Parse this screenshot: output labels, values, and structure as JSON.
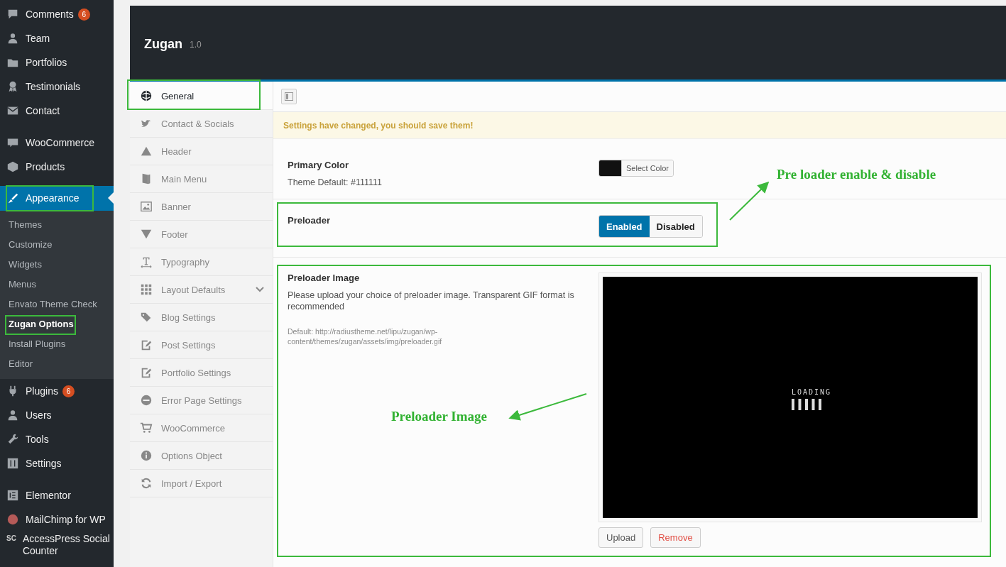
{
  "sidebar": {
    "groups": [
      [
        {
          "label": "Comments",
          "badge": "6",
          "selected": false,
          "highlighted": false
        },
        {
          "label": "Team",
          "selected": false,
          "highlighted": false
        },
        {
          "label": "Portfolios",
          "selected": false,
          "highlighted": false
        },
        {
          "label": "Testimonials",
          "selected": false,
          "highlighted": false
        },
        {
          "label": "Contact",
          "selected": false,
          "highlighted": false
        }
      ],
      [
        {
          "label": "WooCommerce",
          "selected": false,
          "highlighted": false
        },
        {
          "label": "Products",
          "selected": false,
          "highlighted": false
        },
        {
          "label": "Appearance",
          "selected": true,
          "highlighted": true,
          "children": [
            {
              "label": "Themes",
              "selected": false,
              "highlighted": false
            },
            {
              "label": "Customize",
              "selected": false,
              "highlighted": false
            },
            {
              "label": "Widgets",
              "selected": false,
              "highlighted": false
            },
            {
              "label": "Menus",
              "selected": false,
              "highlighted": false
            },
            {
              "label": "Envato Theme Check",
              "selected": false,
              "highlighted": false
            },
            {
              "label": "Zugan Options",
              "selected": true,
              "highlighted": true
            },
            {
              "label": "Install Plugins",
              "selected": false,
              "highlighted": false
            },
            {
              "label": "Editor",
              "selected": false,
              "highlighted": false
            }
          ]
        },
        {
          "label": "Plugins",
          "badge": "6",
          "selected": false,
          "highlighted": false
        },
        {
          "label": "Users",
          "selected": false,
          "highlighted": false
        },
        {
          "label": "Tools",
          "selected": false,
          "highlighted": false
        },
        {
          "label": "Settings",
          "selected": false,
          "highlighted": false
        }
      ],
      [
        {
          "label": "Elementor",
          "selected": false,
          "highlighted": false
        },
        {
          "label": "MailChimp for WP",
          "selected": false,
          "highlighted": false
        },
        {
          "label": "AccessPress Social Counter",
          "icon_text": "SC",
          "selected": false,
          "highlighted": false
        }
      ]
    ]
  },
  "panel": {
    "title": "Zugan",
    "version": "1.0",
    "nav": [
      {
        "label": "General",
        "selected": true,
        "highlighted": true,
        "expandable": false
      },
      {
        "label": "Contact & Socials",
        "selected": false,
        "highlighted": false,
        "expandable": false
      },
      {
        "label": "Header",
        "selected": false,
        "highlighted": false,
        "expandable": false
      },
      {
        "label": "Main Menu",
        "selected": false,
        "highlighted": false,
        "expandable": false
      },
      {
        "label": "Banner",
        "selected": false,
        "highlighted": false,
        "expandable": false
      },
      {
        "label": "Footer",
        "selected": false,
        "highlighted": false,
        "expandable": false
      },
      {
        "label": "Typography",
        "selected": false,
        "highlighted": false,
        "expandable": false
      },
      {
        "label": "Layout Defaults",
        "selected": false,
        "highlighted": false,
        "expandable": true
      },
      {
        "label": "Blog Settings",
        "selected": false,
        "highlighted": false,
        "expandable": false
      },
      {
        "label": "Post Settings",
        "selected": false,
        "highlighted": false,
        "expandable": false
      },
      {
        "label": "Portfolio Settings",
        "selected": false,
        "highlighted": false,
        "expandable": false
      },
      {
        "label": "Error Page Settings",
        "selected": false,
        "highlighted": false,
        "expandable": false
      },
      {
        "label": "WooCommerce",
        "selected": false,
        "highlighted": false,
        "expandable": false
      },
      {
        "label": "Options Object",
        "selected": false,
        "highlighted": false,
        "expandable": false
      },
      {
        "label": "Import / Export",
        "selected": false,
        "highlighted": false,
        "expandable": false
      }
    ],
    "notice": "Settings have changed, you should save them!",
    "fields": [
      {
        "kind": "color",
        "title": "Primary Color",
        "description": "Theme Default: #111111",
        "color": "#111111",
        "button": "Select Color",
        "highlighted": false
      },
      {
        "kind": "toggle",
        "title": "Preloader",
        "options": [
          {
            "label": "Enabled",
            "selected": true
          },
          {
            "label": "Disabled",
            "selected": false
          }
        ],
        "highlighted": true
      },
      {
        "kind": "media",
        "title": "Preloader Image",
        "description": "Please upload your choice of preloader image. Transparent GIF format is recommended",
        "default": "Default: http://radiustheme.net/lipu/zugan/wp-content/themes/zugan/assets/img/preloader.gif",
        "preview_text": "LOADING",
        "buttons": [
          {
            "label": "Upload",
            "kind": "upload"
          },
          {
            "label": "Remove",
            "kind": "remove"
          }
        ],
        "highlighted": true
      }
    ]
  },
  "annotations": [
    {
      "text": "Pre loader enable & disable"
    },
    {
      "text": "Preloader Image"
    }
  ]
}
